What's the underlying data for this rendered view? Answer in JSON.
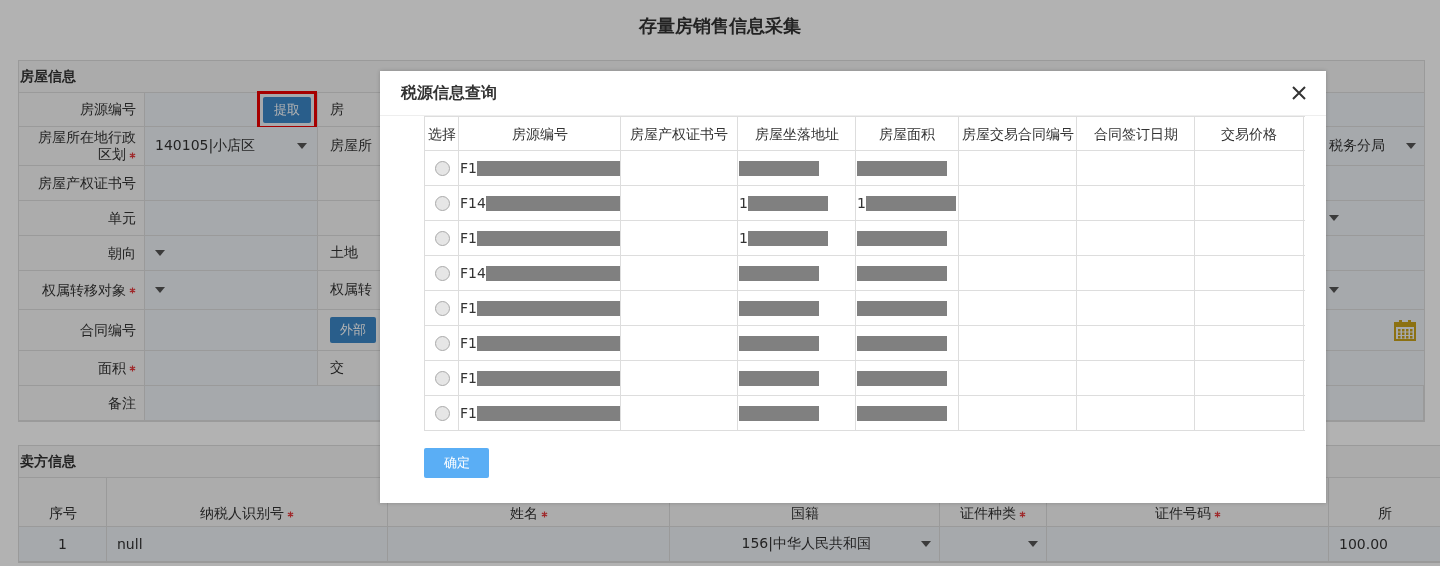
{
  "page_title": "存量房销售信息采集",
  "house_section": {
    "title": "房屋信息",
    "rows": [
      {
        "label": "房源编号",
        "required": false,
        "field": {
          "kind": "button",
          "label": "提取",
          "highlighted": true
        },
        "label2": "房",
        "right": {
          "kind": "input"
        }
      },
      {
        "label": "房屋所在地行政区划",
        "required": true,
        "field": {
          "kind": "select",
          "value": "140105|小店区"
        },
        "label2": "房屋所",
        "right": {
          "kind": "select",
          "value": "税务分局"
        }
      },
      {
        "label": "房屋产权证书号",
        "required": false,
        "field": {
          "kind": "input"
        },
        "right": {
          "kind": "input"
        }
      },
      {
        "label": "单元",
        "required": false,
        "field": {
          "kind": "input"
        },
        "right": {
          "kind": "select"
        }
      },
      {
        "label": "朝向",
        "required": false,
        "field": {
          "kind": "select"
        },
        "label2": "土地",
        "right": {
          "kind": "input"
        }
      },
      {
        "label": "权属转移对象",
        "required": true,
        "field": {
          "kind": "select"
        },
        "label2": "权属转",
        "right": {
          "kind": "select"
        }
      },
      {
        "label": "合同编号",
        "required": false,
        "field": {
          "kind": "input"
        },
        "button2": "外部",
        "right": {
          "kind": "date"
        }
      },
      {
        "label": "面积",
        "required": true,
        "field": {
          "kind": "input"
        },
        "label2": "交",
        "right": {
          "kind": "input"
        }
      },
      {
        "label": "备注",
        "required": false,
        "field": {
          "kind": "textarea"
        }
      }
    ]
  },
  "seller_section": {
    "title": "卖方信息",
    "columns": [
      {
        "label": "序号",
        "required": false
      },
      {
        "label": "纳税人识别号",
        "required": true
      },
      {
        "label": "姓名",
        "required": true
      },
      {
        "label": "国籍",
        "required": false
      },
      {
        "label": "证件种类",
        "required": true
      },
      {
        "label": "证件号码",
        "required": true
      },
      {
        "label": "所",
        "required": false
      }
    ],
    "rows": [
      {
        "cells": [
          {
            "kind": "text",
            "value": "1"
          },
          {
            "kind": "input",
            "value": "null"
          },
          {
            "kind": "input"
          },
          {
            "kind": "select",
            "value": "156|中华人民共和国"
          },
          {
            "kind": "select"
          },
          {
            "kind": "input"
          },
          {
            "kind": "input",
            "value": "100.00"
          }
        ]
      }
    ]
  },
  "modal": {
    "title": "税源信息查询",
    "columns": [
      "选择",
      "房源编号",
      "房屋产权证书号",
      "房屋坐落地址",
      "房屋面积",
      "房屋交易合同编号",
      "合同签订日期",
      "交易价格"
    ],
    "rows": [
      {
        "selected": false,
        "id": "F1",
        "address": "",
        "area": ""
      },
      {
        "selected": false,
        "id": "F14",
        "address": "1",
        "area": "1"
      },
      {
        "selected": false,
        "id": "F1",
        "address": "1",
        "area": ""
      },
      {
        "selected": false,
        "id": "F14",
        "address": "",
        "area": ""
      },
      {
        "selected": false,
        "id": "F1",
        "address": "",
        "area": ""
      },
      {
        "selected": false,
        "id": "F1",
        "address": "",
        "area": ""
      },
      {
        "selected": false,
        "id": "F1",
        "address": "",
        "area": ""
      },
      {
        "selected": false,
        "id": "F1",
        "address": "",
        "area": ""
      }
    ],
    "confirm": "确定"
  }
}
